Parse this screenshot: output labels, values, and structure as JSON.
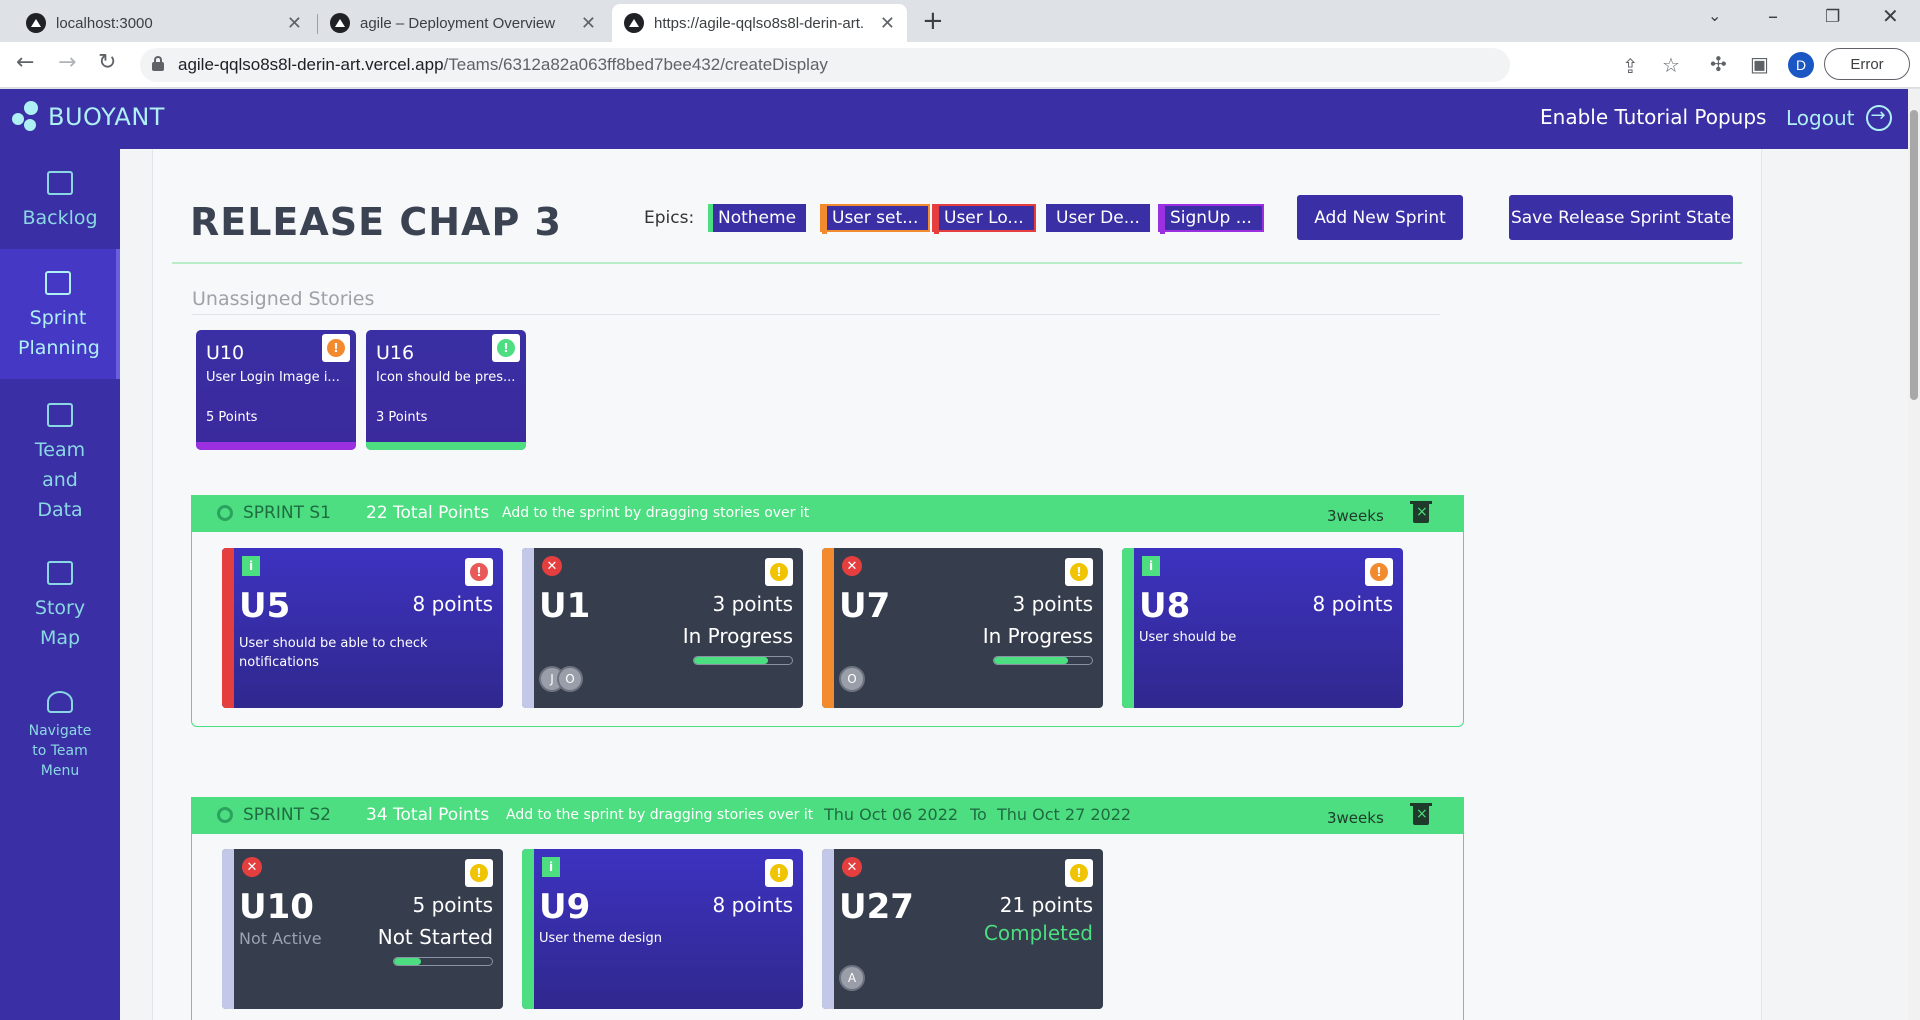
{
  "browser": {
    "tabs": [
      {
        "title": "localhost:3000"
      },
      {
        "title": "agile – Deployment Overview"
      },
      {
        "title": "https://agile-qqlso8s8l-derin-art."
      }
    ],
    "url_host": "agile-qqlso8s8l-derin-art.vercel.app",
    "url_path": "/Teams/6312a82a063ff8bed7bee432/createDisplay",
    "profile_initial": "D",
    "error_label": "Error"
  },
  "app": {
    "logo": "BUOYANT",
    "tutorial": "Enable Tutorial Popups",
    "logout": "Logout",
    "accent": "#3a2fa4",
    "green": "#4cde80"
  },
  "sidebar": {
    "items": [
      {
        "label": "Backlog",
        "icon": "folder-icon"
      },
      {
        "label": "Sprint Planning",
        "icon": "add-folder-icon"
      },
      {
        "label": "Team and Data",
        "icon": "chart-icon"
      },
      {
        "label": "Story Map",
        "icon": "map-icon"
      },
      {
        "label": "Navigate to Team Menu",
        "icon": "team-icon"
      }
    ]
  },
  "release": {
    "title": "RELEASE CHAP 3",
    "epics_label": "Epics:",
    "epics": [
      {
        "label": "Notheme",
        "color": "#4cde80"
      },
      {
        "label": "User set...",
        "color": "#f28b30"
      },
      {
        "label": "User Lo...",
        "color": "#e53e3e"
      },
      {
        "label": "User De...",
        "color": "#3a2fa4"
      },
      {
        "label": "SignUp ...",
        "color": "#9b30e0"
      }
    ],
    "add_sprint": "Add New Sprint",
    "save_state": "Save Release Sprint State"
  },
  "unassigned": {
    "title": "Unassigned Stories",
    "stories": [
      {
        "id": "U10",
        "desc": "User Login Image i...",
        "points": "5 Points",
        "priority_color": "#f28b30",
        "bar_color": "#9b30e0"
      },
      {
        "id": "U16",
        "desc": "Icon should be pres...",
        "points": "3 Points",
        "priority_color": "#4cde80",
        "bar_color": "#4cde80"
      }
    ]
  },
  "sprints": [
    {
      "name": "SPRINT S1",
      "points": "22 Total Points",
      "hint": "Add to the sprint by dragging stories over it",
      "weeks": "3weeks",
      "cards": [
        {
          "id": "U5",
          "points": "8 points",
          "desc": "User should be able to check notifications",
          "edge": "#e53e3e",
          "priority": "#e85a5a",
          "type": "i"
        },
        {
          "id": "U1",
          "points": "3 points",
          "status": "In Progress",
          "progress": 0.75,
          "edge": "#c3c8e8",
          "priority": "#f0c400",
          "type": "x",
          "avatars": [
            "J",
            "O"
          ]
        },
        {
          "id": "U7",
          "points": "3 points",
          "status": "In Progress",
          "progress": 0.75,
          "edge": "#f28b30",
          "priority": "#f0c400",
          "type": "x",
          "avatars": [
            "O"
          ]
        },
        {
          "id": "U8",
          "points": "8 points",
          "desc": "User should be",
          "edge": "#4cde80",
          "priority": "#f28b30",
          "type": "i"
        }
      ]
    },
    {
      "name": "SPRINT S2",
      "points": "34 Total Points",
      "hint": "Add to the sprint by dragging stories over it",
      "date_from": "Thu Oct 06 2022",
      "date_sep": "To",
      "date_to": "Thu Oct 27 2022",
      "weeks": "3weeks",
      "cards": [
        {
          "id": "U10",
          "points": "5 points",
          "sub": "Not Active",
          "status": "Not Started",
          "progress": 0.28,
          "edge": "#c3c8e8",
          "priority": "#f0c400",
          "type": "x"
        },
        {
          "id": "U9",
          "points": "8 points",
          "desc": "User theme design",
          "edge": "#4cde80",
          "priority": "#f0c400",
          "type": "i"
        },
        {
          "id": "U27",
          "points": "21 points",
          "status": "Completed",
          "edge": "#c3c8e8",
          "priority": "#f0c400",
          "type": "x",
          "avatars": [
            "A"
          ]
        }
      ]
    }
  ]
}
